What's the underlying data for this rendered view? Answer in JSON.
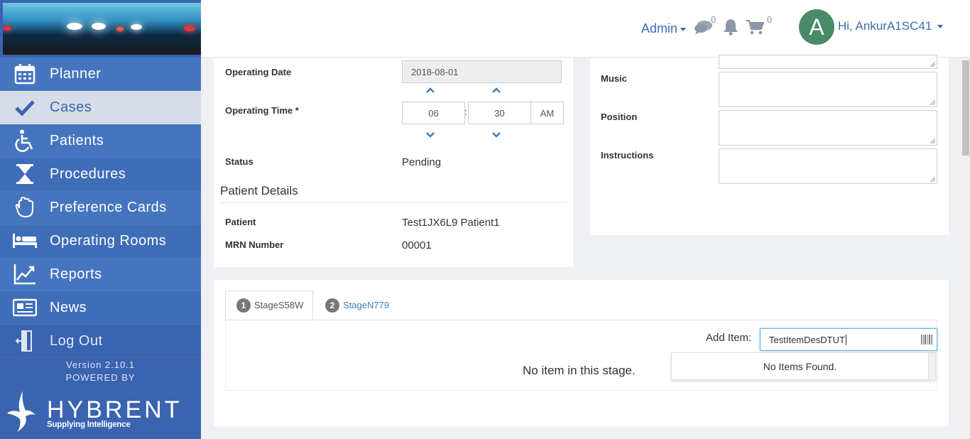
{
  "sidebar": {
    "items": [
      {
        "label": "Planner",
        "icon": "calendar-icon"
      },
      {
        "label": "Cases",
        "icon": "checkmark-icon"
      },
      {
        "label": "Patients",
        "icon": "wheelchair-icon"
      },
      {
        "label": "Procedures",
        "icon": "hourglass-icon"
      },
      {
        "label": "Preference Cards",
        "icon": "glove-icon"
      },
      {
        "label": "Operating Rooms",
        "icon": "bed-icon"
      },
      {
        "label": "Reports",
        "icon": "line-chart-icon"
      },
      {
        "label": "News",
        "icon": "newspaper-icon"
      },
      {
        "label": "Log Out",
        "icon": "door-exit-icon"
      }
    ],
    "version": "Version 2.10.1",
    "powered_by": "POWERED BY",
    "brand": "HYBRENT",
    "tagline": "Supplying Intelligence"
  },
  "header": {
    "admin_label": "Admin",
    "messages_count": "0",
    "cart_count": "0",
    "avatar_letter": "A",
    "user_greeting": "Hi, AnkurA1SC41"
  },
  "case_details": {
    "operating_date_label": "Operating Date",
    "operating_date_value": "2018-08-01",
    "operating_time_label": "Operating Time *",
    "hour": "06",
    "time_separator": ":",
    "minute": "30",
    "meridiem": "AM",
    "status_label": "Status",
    "status_value": "Pending"
  },
  "patient_details": {
    "heading": "Patient Details",
    "patient_label": "Patient",
    "patient_value": "Test1JX6L9 Patient1",
    "mrn_label": "MRN Number",
    "mrn_value": "00001"
  },
  "notes": {
    "music_label": "Music",
    "position_label": "Position",
    "instructions_label": "Instructions"
  },
  "stages": {
    "tabs": [
      {
        "num": "1",
        "label": "StageS58W",
        "active": true
      },
      {
        "num": "2",
        "label": "StageN779",
        "active": false
      }
    ],
    "add_item_label": "Add Item:",
    "add_item_value": "TestItemDesDTUT",
    "empty_message": "No item in this stage.",
    "dropdown_message": "No Items Found."
  },
  "colors": {
    "sidebar": "#3a63b0",
    "link": "#3a6fb0",
    "avatar": "#4a8a68"
  }
}
